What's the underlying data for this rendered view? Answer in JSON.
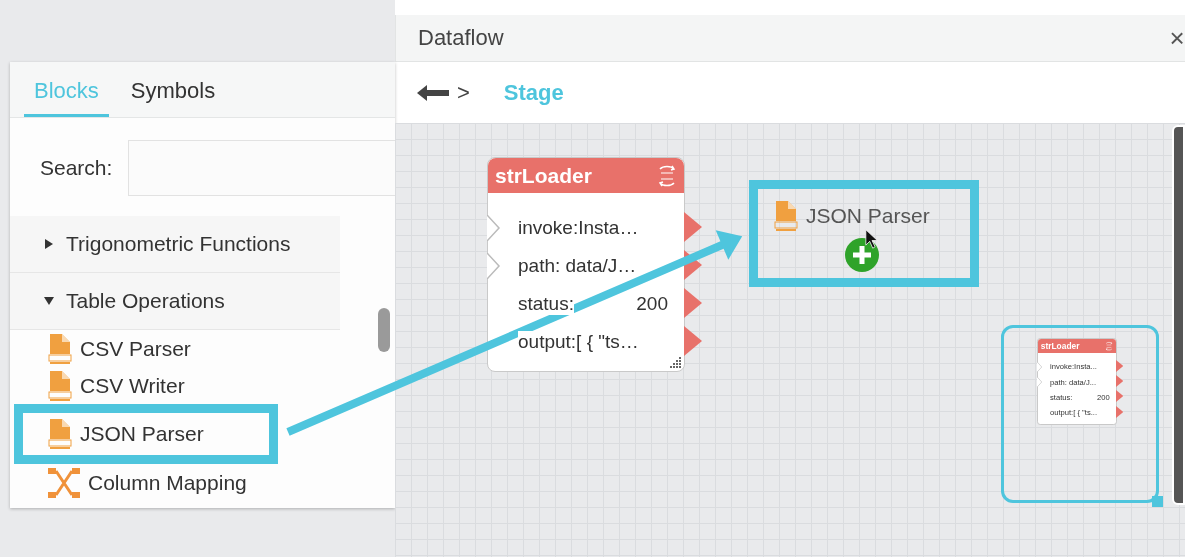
{
  "sidebar": {
    "tabs": [
      {
        "label": "Blocks",
        "selected": true
      },
      {
        "label": "Symbols",
        "selected": false
      }
    ],
    "search": {
      "label": "Search:"
    },
    "categories": [
      {
        "label": "Trigonometric Functions",
        "expanded": false
      },
      {
        "label": "Table Operations",
        "expanded": true,
        "children": [
          {
            "label": "CSV Parser",
            "kind": "csv",
            "highlighted": false
          },
          {
            "label": "CSV Writer",
            "kind": "csv",
            "highlighted": false
          },
          {
            "label": "JSON Parser",
            "kind": "json",
            "highlighted": true
          },
          {
            "label": "Column Mapping",
            "kind": "mapping",
            "highlighted": false
          }
        ]
      }
    ]
  },
  "window": {
    "title": "Dataflow",
    "close": "×"
  },
  "breadcrumb": {
    "separator": ">",
    "current": "Stage"
  },
  "node": {
    "title": "strLoader",
    "ports": [
      {
        "label": "invoke:Insta…",
        "input": true
      },
      {
        "label": "path: data/J…",
        "input": true
      },
      {
        "label": "status:",
        "value": "200",
        "input": false
      },
      {
        "label": "output:[ { \"ts…",
        "input": false
      }
    ]
  },
  "drag_preview": {
    "label": "JSON Parser",
    "kind": "json",
    "adding": true
  },
  "minimap": {
    "title": "strLoader",
    "ports": [
      {
        "label": "invoke:Insta...",
        "input": true
      },
      {
        "label": "path: data/J...",
        "input": true
      },
      {
        "label": "status:",
        "value": "200",
        "input": false
      },
      {
        "label": "output:[ { \"ts...",
        "input": false
      }
    ]
  }
}
